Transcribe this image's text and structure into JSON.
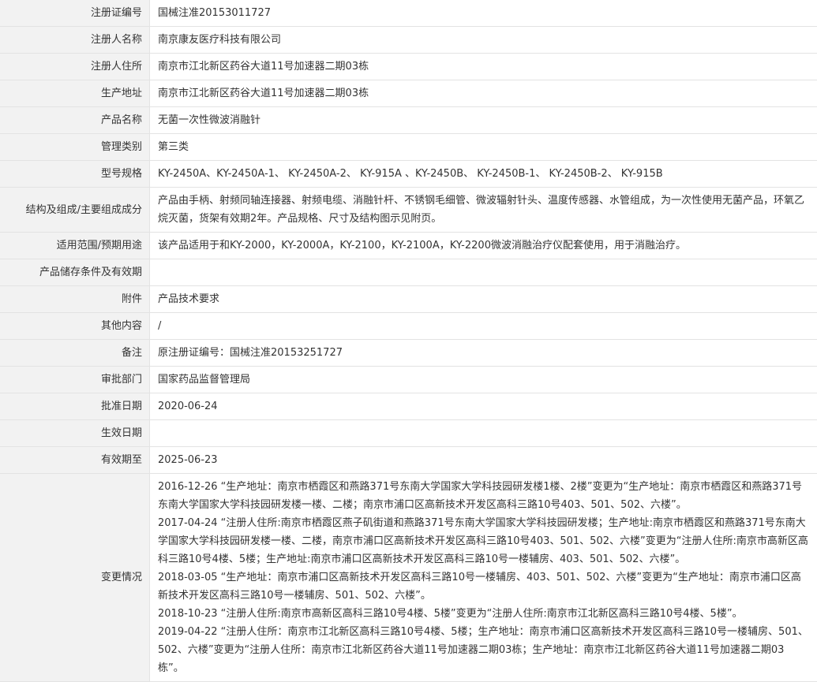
{
  "rows": [
    {
      "label": "注册证编号",
      "value": "国械注准20153011727"
    },
    {
      "label": "注册人名称",
      "value": "南京康友医疗科技有限公司"
    },
    {
      "label": "注册人住所",
      "value": "南京市江北新区药谷大道11号加速器二期03栋"
    },
    {
      "label": "生产地址",
      "value": "南京市江北新区药谷大道11号加速器二期03栋"
    },
    {
      "label": "产品名称",
      "value": "无菌一次性微波消融针"
    },
    {
      "label": "管理类别",
      "value": "第三类"
    },
    {
      "label": "型号规格",
      "value": "KY-2450A、KY-2450A-1、 KY-2450A-2、 KY-915A 、KY-2450B、 KY-2450B-1、 KY-2450B-2、 KY-915B"
    },
    {
      "label": "结构及组成/主要组成成分",
      "value": "产品由手柄、射频同轴连接器、射频电缆、消融针杆、不锈钢毛细管、微波辐射针头、温度传感器、水管组成，为一次性使用无菌产品，环氧乙烷灭菌，货架有效期2年。产品规格、尺寸及结构图示见附页。"
    },
    {
      "label": "适用范围/预期用途",
      "value": "该产品适用于和KY-2000，KY-2000A，KY-2100，KY-2100A，KY-2200微波消融治疗仪配套使用，用于消融治疗。"
    },
    {
      "label": "产品储存条件及有效期",
      "value": ""
    },
    {
      "label": "附件",
      "value": "产品技术要求"
    },
    {
      "label": "其他内容",
      "value": "/"
    },
    {
      "label": "备注",
      "value": "原注册证编号：国械注准20153251727"
    },
    {
      "label": "审批部门",
      "value": "国家药品监督管理局"
    },
    {
      "label": "批准日期",
      "value": "2020-06-24"
    },
    {
      "label": "生效日期",
      "value": ""
    },
    {
      "label": "有效期至",
      "value": "2025-06-23"
    }
  ],
  "changes": {
    "label": "变更情况",
    "entries": [
      "2016-12-26 “生产地址：南京市栖霞区和燕路371号东南大学国家大学科技园研发楼1楼、2楼”变更为“生产地址：南京市栖霞区和燕路371号东南大学国家大学科技园研发楼一楼、二楼；南京市浦口区高新技术开发区高科三路10号403、501、502、六楼”。",
      "2017-04-24 “注册人住所:南京市栖霞区燕子矶街道和燕路371号东南大学国家大学科技园研发楼；生产地址:南京市栖霞区和燕路371号东南大学国家大学科技园研发楼一楼、二楼，南京市浦口区高新技术开发区高科三路10号403、501、502、六楼”变更为“注册人住所:南京市高新区高科三路10号4楼、5楼；生产地址:南京市浦口区高新技术开发区高科三路10号一楼辅房、403、501、502、六楼”。",
      "2018-03-05 “生产地址：南京市浦口区高新技术开发区高科三路10号一楼辅房、403、501、502、六楼”变更为“生产地址：南京市浦口区高新技术开发区高科三路10号一楼辅房、501、502、六楼”。",
      "2018-10-23 “注册人住所:南京市高新区高科三路10号4楼、5楼”变更为“注册人住所:南京市江北新区高科三路10号4楼、5楼”。",
      "2019-04-22 “注册人住所：南京市江北新区高科三路10号4楼、5楼；生产地址：南京市浦口区高新技术开发区高科三路10号一楼辅房、501、502、六楼”变更为“注册人住所：南京市江北新区药谷大道11号加速器二期03栋；生产地址：南京市江北新区药谷大道11号加速器二期03栋”。"
    ]
  }
}
